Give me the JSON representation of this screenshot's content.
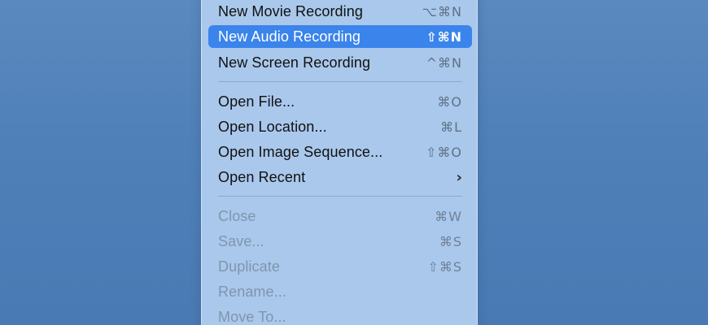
{
  "menu": {
    "group1": [
      {
        "label": "New Movie Recording",
        "shortcut": "⌥⌘N"
      },
      {
        "label": "New Audio Recording",
        "shortcut": "⇧⌘N"
      },
      {
        "label": "New Screen Recording",
        "shortcut": "^⌘N"
      }
    ],
    "group2": [
      {
        "label": "Open File...",
        "shortcut": "⌘O"
      },
      {
        "label": "Open Location...",
        "shortcut": "⌘L"
      },
      {
        "label": "Open Image Sequence...",
        "shortcut": "⇧⌘O"
      },
      {
        "label": "Open Recent",
        "submenu_icon": "chevron-right-icon"
      }
    ],
    "group3": [
      {
        "label": "Close",
        "shortcut": "⌘W"
      },
      {
        "label": "Save...",
        "shortcut": "⌘S"
      },
      {
        "label": "Duplicate",
        "shortcut": "⇧⌘S"
      },
      {
        "label": "Rename..."
      },
      {
        "label": "Move To..."
      }
    ],
    "highlighted_item": "New Audio Recording",
    "highlight_color": "#3a84eb",
    "background_color": "#a9c8ec",
    "desktop_color": "#4f80b8"
  }
}
